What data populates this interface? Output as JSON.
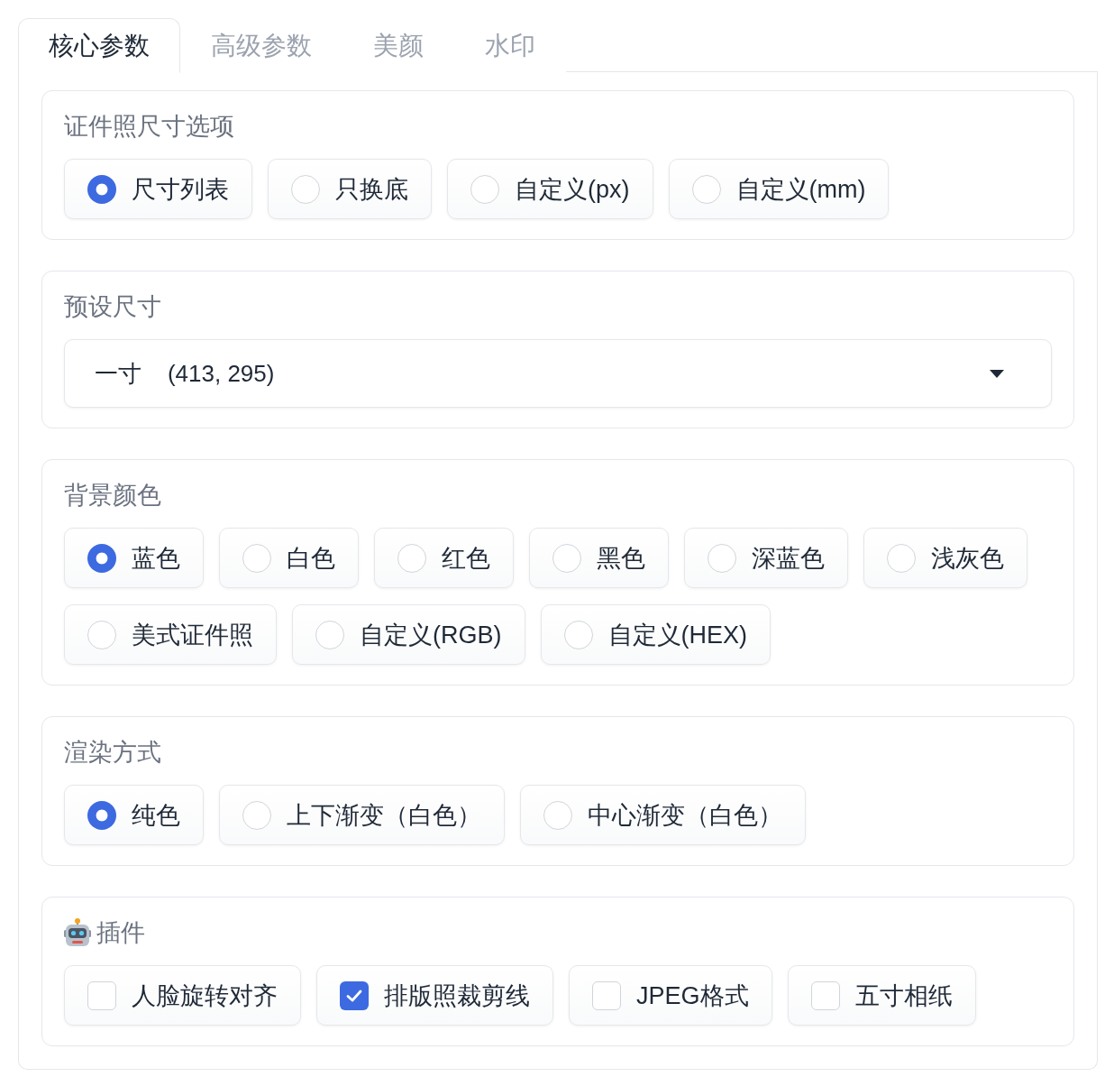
{
  "tabs": [
    {
      "label": "核心参数",
      "selected": true
    },
    {
      "label": "高级参数",
      "selected": false
    },
    {
      "label": "美颜",
      "selected": false
    },
    {
      "label": "水印",
      "selected": false
    }
  ],
  "sections": [
    {
      "kind": "radio",
      "label": "证件照尺寸选项",
      "icon": false,
      "options": [
        {
          "label": "尺寸列表",
          "selected": true
        },
        {
          "label": "只换底",
          "selected": false
        },
        {
          "label": "自定义(px)",
          "selected": false
        },
        {
          "label": "自定义(mm)",
          "selected": false
        }
      ]
    },
    {
      "kind": "dropdown",
      "label": "预设尺寸",
      "icon": false,
      "value": "一寸    (413, 295)"
    },
    {
      "kind": "radio",
      "label": "背景颜色",
      "icon": false,
      "options": [
        {
          "label": "蓝色",
          "selected": true
        },
        {
          "label": "白色",
          "selected": false
        },
        {
          "label": "红色",
          "selected": false
        },
        {
          "label": "黑色",
          "selected": false
        },
        {
          "label": "深蓝色",
          "selected": false
        },
        {
          "label": "浅灰色",
          "selected": false
        },
        {
          "label": "美式证件照",
          "selected": false
        },
        {
          "label": "自定义(RGB)",
          "selected": false
        },
        {
          "label": "自定义(HEX)",
          "selected": false
        }
      ]
    },
    {
      "kind": "radio",
      "label": "渲染方式",
      "icon": false,
      "options": [
        {
          "label": "纯色",
          "selected": true
        },
        {
          "label": "上下渐变（白色）",
          "selected": false
        },
        {
          "label": "中心渐变（白色）",
          "selected": false
        }
      ]
    },
    {
      "kind": "checkbox",
      "label": "插件",
      "icon": true,
      "options": [
        {
          "label": "人脸旋转对齐",
          "checked": false
        },
        {
          "label": "排版照裁剪线",
          "checked": true
        },
        {
          "label": "JPEG格式",
          "checked": false
        },
        {
          "label": "五寸相纸",
          "checked": false
        }
      ]
    }
  ]
}
